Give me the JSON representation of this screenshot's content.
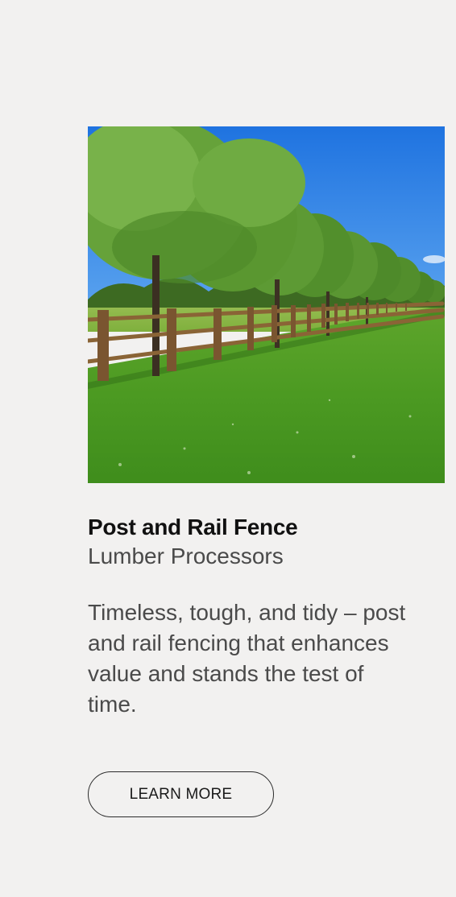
{
  "card": {
    "image_alt": "Wooden post and rail fence lined with trees beside a green lawn",
    "title": "Post and Rail Fence",
    "subtitle": "Lumber Processors",
    "description": "Timeless, tough, and tidy – post and rail fencing that enhances value and stands the test of time.",
    "cta_label": "LEARN MORE"
  },
  "colors": {
    "background": "#f2f1f0",
    "title": "#111111",
    "body_text": "#4a4a4a",
    "button_border": "#2b2b2b"
  }
}
